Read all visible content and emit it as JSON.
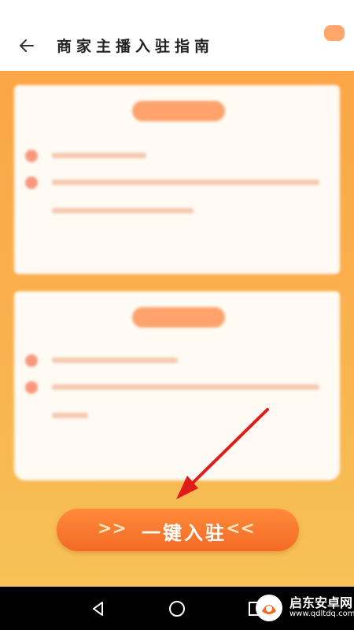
{
  "header": {
    "title": "商家主播入驻指南"
  },
  "cta": {
    "label": "一键入驻",
    "arrows_left": ">>",
    "arrows_right": "<<"
  },
  "colors": {
    "accent": "#f26b25",
    "background": "#f9b24f",
    "pointer_arrow": "#e01b1b"
  },
  "icons": {
    "back": "back-arrow-icon",
    "nav_back": "triangle-back-icon",
    "nav_home": "circle-home-icon",
    "nav_recent": "square-recent-icon"
  },
  "watermark": {
    "name": "启东安卓网",
    "url": "www.qdltdq.com"
  }
}
